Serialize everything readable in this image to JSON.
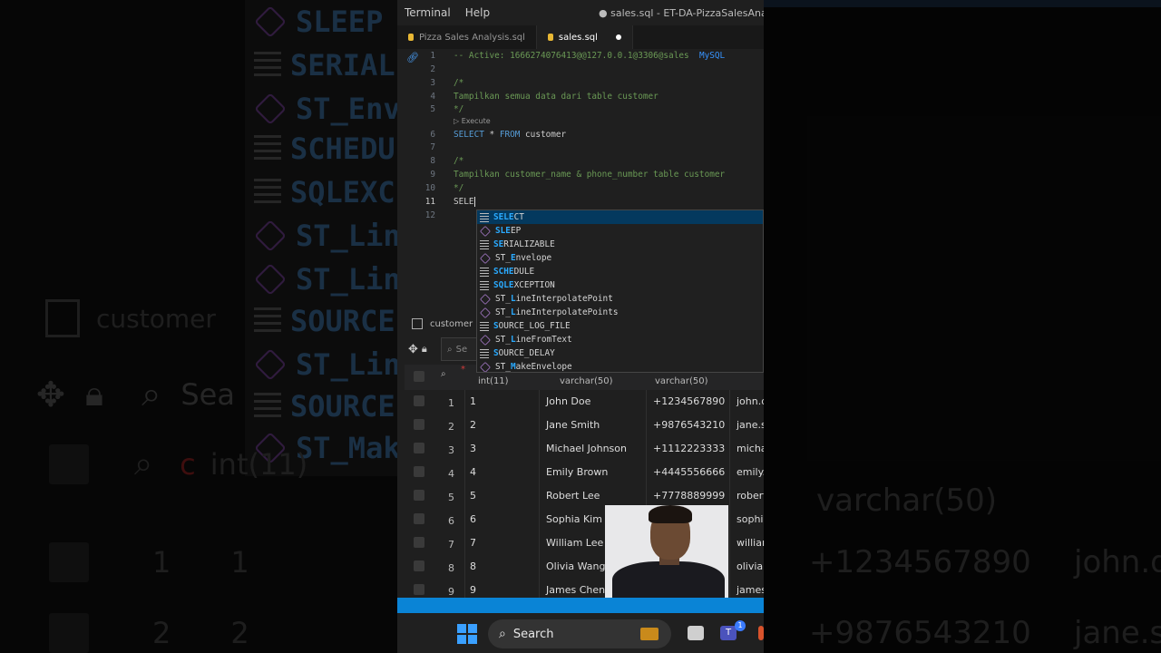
{
  "menu": {
    "terminal": "Terminal",
    "help": "Help",
    "title": "● sales.sql - ET-DA-PizzaSalesAnalysis"
  },
  "tabs": [
    {
      "label": "Pizza Sales Analysis.sql"
    },
    {
      "label": "sales.sql"
    }
  ],
  "editor": {
    "line_numbers": [
      "1",
      "2",
      "3",
      "4",
      "5",
      "6",
      "7",
      "8",
      "9",
      "10",
      "11",
      "12"
    ],
    "line1_comment": "-- Active: 1666274076413@@127.0.0.1@3306@sales",
    "line1_db": "MySQL",
    "line3": "/*",
    "line4": "Tampilkan semua data dari table customer",
    "line5": "*/",
    "codelens": "Execute",
    "line6_select": "SELECT",
    "line6_star": " * ",
    "line6_from": "FROM",
    "line6_table": " customer",
    "line8": "/*",
    "line9": "Tampilkan customer_name & phone_number table customer",
    "line10": "*/",
    "line11": "SELE"
  },
  "suggestions": [
    {
      "pre": "",
      "hl": "SELE",
      "post": "CT",
      "icon": "keyword"
    },
    {
      "pre": "",
      "hl": "SLE",
      "post": "EP",
      "icon": "cube"
    },
    {
      "pre": "",
      "hl": "SE",
      "post": "RIALIZABLE",
      "icon": "keyword"
    },
    {
      "pre": "ST_",
      "hl": "E",
      "post": "nvelope",
      "icon": "cube"
    },
    {
      "pre": "",
      "hl": "SCHE",
      "post": "DULE",
      "icon": "keyword"
    },
    {
      "pre": "",
      "hl": "SQLE",
      "post": "XCEPTION",
      "icon": "keyword"
    },
    {
      "pre": "ST_",
      "hl": "L",
      "post": "ineInterpolatePoint",
      "icon": "cube"
    },
    {
      "pre": "ST_",
      "hl": "L",
      "post": "ineInterpolatePoints",
      "icon": "cube"
    },
    {
      "pre": "",
      "hl": "S",
      "post": "OURCE_LOG_FILE",
      "icon": "keyword"
    },
    {
      "pre": "ST_",
      "hl": "L",
      "post": "ineFromText",
      "icon": "cube"
    },
    {
      "pre": "",
      "hl": "S",
      "post": "OURCE_DELAY",
      "icon": "keyword"
    },
    {
      "pre": "ST_",
      "hl": "M",
      "post": "akeEnvelope",
      "icon": "cube"
    }
  ],
  "results": {
    "tab_label": "customer",
    "search_placeholder": "Se",
    "columns": [
      "int(11)",
      "varchar(50)",
      "varchar(50)"
    ],
    "rows": [
      {
        "n": "1",
        "id": "1",
        "name": "John Doe",
        "phone": "+1234567890",
        "email": "john.d"
      },
      {
        "n": "2",
        "id": "2",
        "name": "Jane Smith",
        "phone": "+9876543210",
        "email": "jane.sı"
      },
      {
        "n": "3",
        "id": "3",
        "name": "Michael Johnson",
        "phone": "+1112223333",
        "email": "micha"
      },
      {
        "n": "4",
        "id": "4",
        "name": "Emily Brown",
        "phone": "+4445556666",
        "email": "emily.l"
      },
      {
        "n": "5",
        "id": "5",
        "name": "Robert Lee",
        "phone": "+7778889999",
        "email": "robert"
      },
      {
        "n": "6",
        "id": "6",
        "name": "Sophia Kim",
        "phone": "",
        "email": "sophia"
      },
      {
        "n": "7",
        "id": "7",
        "name": "William Lee",
        "phone": "",
        "email": "willian"
      },
      {
        "n": "8",
        "id": "8",
        "name": "Olivia Wang",
        "phone": "",
        "email": "olivia.v"
      },
      {
        "n": "9",
        "id": "9",
        "name": "James Chen",
        "phone": "",
        "email": "james."
      }
    ]
  },
  "taskbar": {
    "search": "Search",
    "badge": "1"
  },
  "background": {
    "left_items": [
      "SLEEP",
      "SERIAL",
      "ST_Env",
      "SCHEDU",
      "SQLEXC",
      "ST_Lin",
      "ST_Lin",
      "SOURCE",
      "ST_Lin",
      "SOURCE",
      "ST_Mak"
    ],
    "left_tab": "customer",
    "left_search": "Sea",
    "left_red": "c",
    "left_col": "int(11)",
    "left_rows": [
      {
        "n": "1",
        "id": "1"
      },
      {
        "n": "2",
        "id": "2"
      }
    ],
    "right_col": "varchar(50)",
    "right_rows": [
      {
        "phone": "+1234567890",
        "email": "john.d"
      },
      {
        "phone": "+9876543210",
        "email": "jane.sı"
      }
    ]
  },
  "colors": {
    "accent": "#0a84d6",
    "selection": "#04395e",
    "comment": "#6a9955",
    "keyword": "#569cd6"
  }
}
